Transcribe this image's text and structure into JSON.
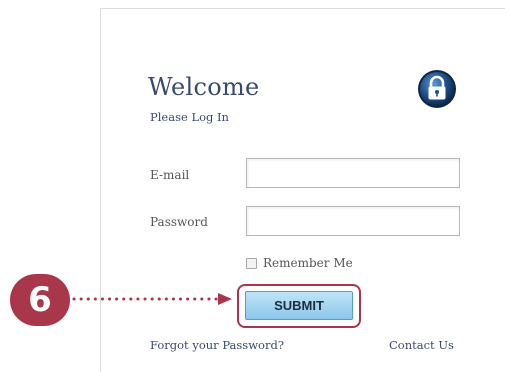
{
  "login": {
    "title": "Welcome",
    "subtitle": "Please Log In",
    "email_label": "E-mail",
    "email_value": "",
    "password_label": "Password",
    "password_value": "",
    "remember_label": "Remember Me",
    "remember_checked": false,
    "submit_label": "SUBMIT",
    "forgot_link": "Forgot your Password?",
    "contact_link": "Contact Us"
  },
  "annotation": {
    "step_number": "6",
    "highlight_color": "#a8374b"
  },
  "icons": {
    "lock": "lock-icon"
  },
  "colors": {
    "heading": "#3a4a6b",
    "button_top": "#bfe4f8",
    "button_bottom": "#8cc7ea",
    "lock_body": "#1f4f8a"
  }
}
